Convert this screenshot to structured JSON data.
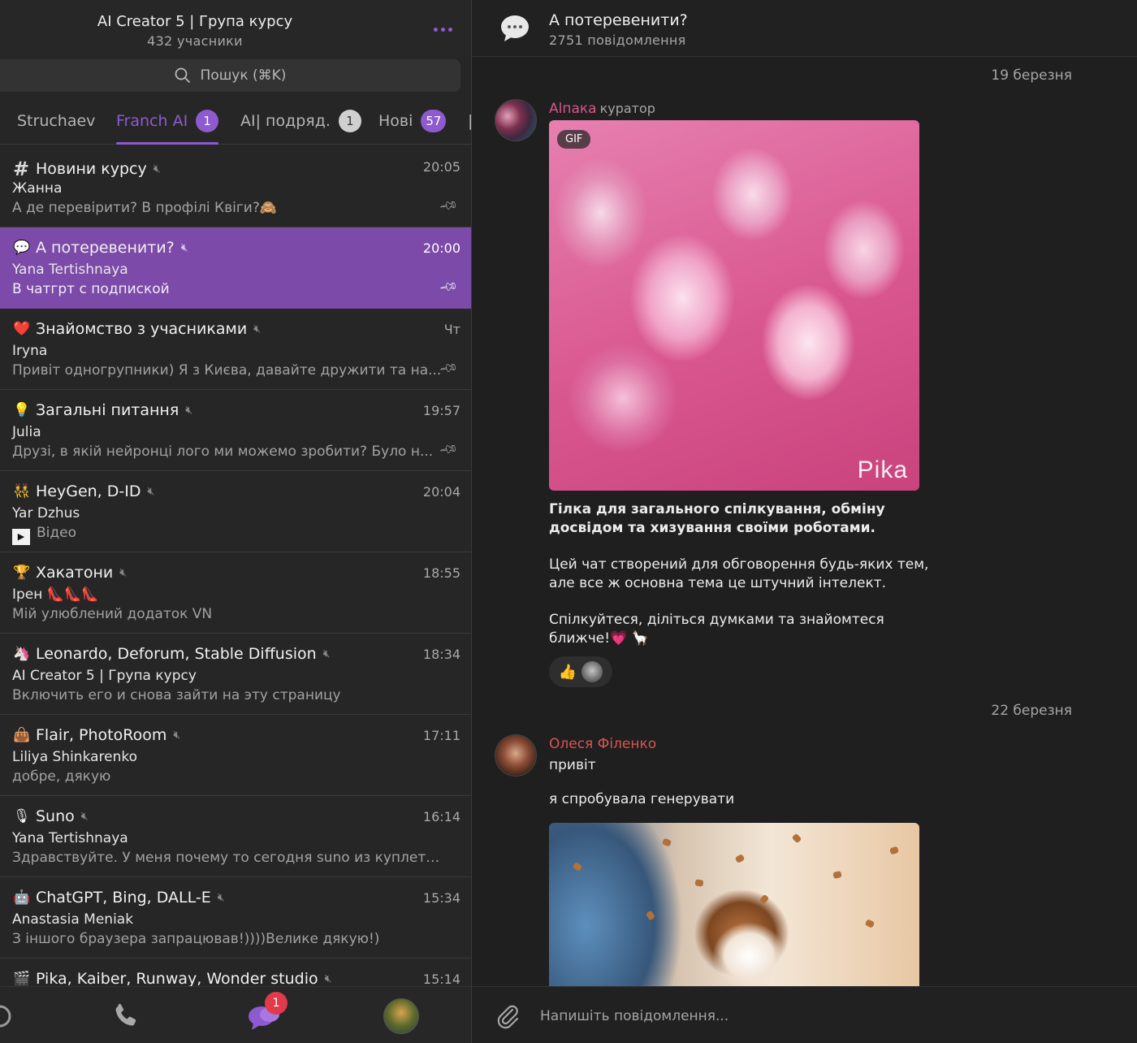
{
  "group": {
    "title": "AI Creator 5 | Група курсу",
    "members": "432 учасники"
  },
  "search": {
    "placeholder": "Пошук (⌘K)"
  },
  "tabs": [
    {
      "label": "Struchaev",
      "badge": ""
    },
    {
      "label": "Franch AI",
      "badge": "1"
    },
    {
      "label": "AI| подряд.",
      "badge": "1"
    },
    {
      "label": "Нові",
      "badge": "57"
    }
  ],
  "chats": [
    {
      "icon": "#",
      "title": "Новини курсу",
      "time": "20:05",
      "sender": "Жанна",
      "preview": "А де перевірити? В профілі Квіги?🙈"
    },
    {
      "icon": "💬",
      "title": "А потеревенити?",
      "time": "20:00",
      "sender": "Yana Tertishnaya",
      "preview": "В чатгрт  с подпиской"
    },
    {
      "icon": "❤️",
      "title": "Знайомство з учасниками",
      "time": "Чт",
      "sender": "Iryna",
      "preview": "Привіт одногрупники) Я з Києва, давайте дружити та на..."
    },
    {
      "icon": "💡",
      "title": "Загальні питання",
      "time": "19:57",
      "sender": "Julia",
      "preview": "Друзі, в якій нейронці лого ми можемо зробити? Було н..."
    },
    {
      "icon": "👯",
      "title": "HeyGen, D-ID",
      "time": "20:04",
      "sender": "Yar Dzhus",
      "preview": "Відео"
    },
    {
      "icon": "🏆",
      "title": "Хакатони",
      "time": "18:55",
      "sender": "Ірен 👠👠👠",
      "preview": "Мій улюблений додаток VN"
    },
    {
      "icon": "🦄",
      "title": "Leonardo, Deforum, Stable Diffusion",
      "time": "18:34",
      "sender": "AI Creator 5 | Група курсу",
      "preview": "Включить его и снова зайти на эту страницу"
    },
    {
      "icon": "👜",
      "title": "Flair, PhotoRoom",
      "time": "17:11",
      "sender": "Liliya Shinkarenko",
      "preview": "добре, дякую"
    },
    {
      "icon": "🎙",
      "title": "Suno",
      "time": "16:14",
      "sender": "Yana Tertishnaya",
      "preview": "Здравствуйте. У меня почему то сегодня suno из куплетов..."
    },
    {
      "icon": "🤖",
      "title": "ChatGPT, Bing, DALL-E",
      "time": "15:34",
      "sender": "Anastasia Meniak",
      "preview": "З іншого браузера запрацював!))))Велике дякую!)"
    },
    {
      "icon": "🎬",
      "title": "Pika, Kaiber, Runway, Wonder studio",
      "time": "15:14",
      "sender": "",
      "preview": ""
    }
  ],
  "nav": {
    "badge": "1"
  },
  "topic": {
    "title": "А потеревенити?",
    "count": "2751 повідомлення"
  },
  "messages": {
    "date1": "19 березня",
    "date2": "22 березня",
    "alpaka": {
      "name": "Alпака",
      "role": "куратор",
      "gif_tag": "GIF",
      "watermark": "Pika",
      "para1": "Гілка для загального спілкування, обміну досвідом та хизування своїми роботами.",
      "para2": "Цей чат створений для обговорення будь-яких тем, але все ж основна тема це штучний інтелект.",
      "para3": "Спілкуйтеся, діліться думками та знайомтеся ближче!💗 🦙",
      "reaction": "👍"
    },
    "olesya": {
      "name": "Олеся Філенко",
      "msg1": "привіт",
      "msg2": "я спробувала генерувати"
    }
  },
  "composer": {
    "placeholder": "Напишіть повідомлення..."
  },
  "colors": {
    "accent": "#8e5ad0",
    "selected_row": "#7c4aa8",
    "badge_red": "#e13a4a",
    "name_pink": "#d9568a",
    "name_red": "#d9564f"
  }
}
